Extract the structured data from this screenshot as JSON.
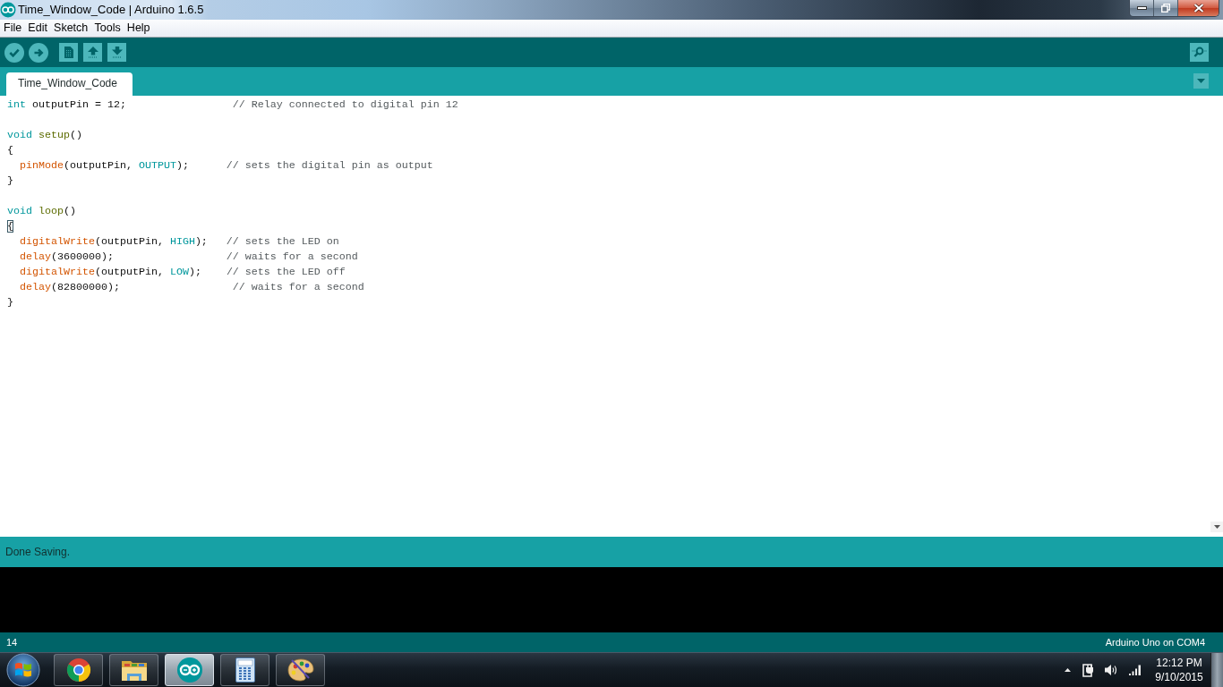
{
  "window": {
    "title": "Time_Window_Code | Arduino 1.6.5"
  },
  "menu": [
    "File",
    "Edit",
    "Sketch",
    "Tools",
    "Help"
  ],
  "tabs": [
    {
      "label": "Time_Window_Code",
      "selected": true
    }
  ],
  "editor": {
    "lines": [
      {
        "kind": "code",
        "bracket_match": false,
        "code": [
          {
            "kind": "type",
            "text": "int"
          },
          {
            "kind": "plain",
            "text": " outputPin = 12;                 "
          },
          {
            "kind": "comment",
            "text": "// Relay connected to digital pin 12"
          }
        ]
      },
      {
        "kind": "blank"
      },
      {
        "kind": "code",
        "bracket_match": false,
        "code": [
          {
            "kind": "type",
            "text": "void "
          },
          {
            "kind": "reserved",
            "text": "setup"
          },
          {
            "kind": "plain",
            "text": "()"
          }
        ]
      },
      {
        "kind": "code",
        "bracket_match": false,
        "code": [
          {
            "kind": "plain",
            "text": "{"
          }
        ],
        "children": [
          {
            "kind": "code",
            "bracket_match": false,
            "code": [
              {
                "kind": "function",
                "text": "pinMode"
              },
              {
                "kind": "plain",
                "text": "(outputPin, "
              },
              {
                "kind": "constant",
                "text": "OUTPUT"
              },
              {
                "kind": "plain",
                "text": ");      "
              },
              {
                "kind": "comment",
                "text": "// sets the digital pin as output"
              }
            ]
          }
        ]
      },
      {
        "kind": "code",
        "bracket_match": false,
        "code": [
          {
            "kind": "plain",
            "text": "}"
          }
        ]
      },
      {
        "kind": "blank"
      },
      {
        "kind": "code",
        "bracket_match": false,
        "code": [
          {
            "kind": "type",
            "text": "void "
          },
          {
            "kind": "reserved",
            "text": "loop"
          },
          {
            "kind": "plain",
            "text": "()"
          }
        ]
      },
      {
        "kind": "code",
        "bracket_match": true,
        "code": [
          {
            "kind": "plain",
            "text": "{"
          }
        ],
        "children": [
          {
            "kind": "code",
            "bracket_match": false,
            "code": [
              {
                "kind": "function",
                "text": "digitalWrite"
              },
              {
                "kind": "plain",
                "text": "(outputPin, "
              },
              {
                "kind": "constant",
                "text": "HIGH"
              },
              {
                "kind": "plain",
                "text": ");   "
              },
              {
                "kind": "comment",
                "text": "// sets the LED on"
              }
            ]
          },
          {
            "kind": "code",
            "bracket_match": false,
            "code": [
              {
                "kind": "function",
                "text": "delay"
              },
              {
                "kind": "plain",
                "text": "(3600000);                  "
              },
              {
                "kind": "comment",
                "text": "// waits for a second"
              }
            ]
          },
          {
            "kind": "code",
            "bracket_match": false,
            "code": [
              {
                "kind": "function",
                "text": "digitalWrite"
              },
              {
                "kind": "plain",
                "text": "(outputPin, "
              },
              {
                "kind": "constant",
                "text": "LOW"
              },
              {
                "kind": "plain",
                "text": ");    "
              },
              {
                "kind": "comment",
                "text": "// sets the LED off"
              }
            ]
          },
          {
            "kind": "code",
            "bracket_match": false,
            "code": [
              {
                "kind": "function",
                "text": "delay"
              },
              {
                "kind": "plain",
                "text": "(82800000);                  "
              },
              {
                "kind": "comment",
                "text": "// waits for a second"
              }
            ]
          }
        ]
      },
      {
        "kind": "code",
        "bracket_match": false,
        "code": [
          {
            "kind": "plain",
            "text": "}"
          }
        ]
      }
    ]
  },
  "status": {
    "message": "Done Saving."
  },
  "footer": {
    "line_number": "14",
    "board": "Arduino Uno on COM4"
  },
  "taskbar": {
    "apps": [
      {
        "kind": "browser",
        "selected": false
      },
      {
        "kind": "files",
        "selected": false
      },
      {
        "kind": "ide",
        "selected": true
      },
      {
        "kind": "calculator",
        "selected": false
      },
      {
        "kind": "paint",
        "selected": false
      }
    ],
    "clock": {
      "time": "12:12 PM",
      "date": "9/10/2015"
    }
  }
}
